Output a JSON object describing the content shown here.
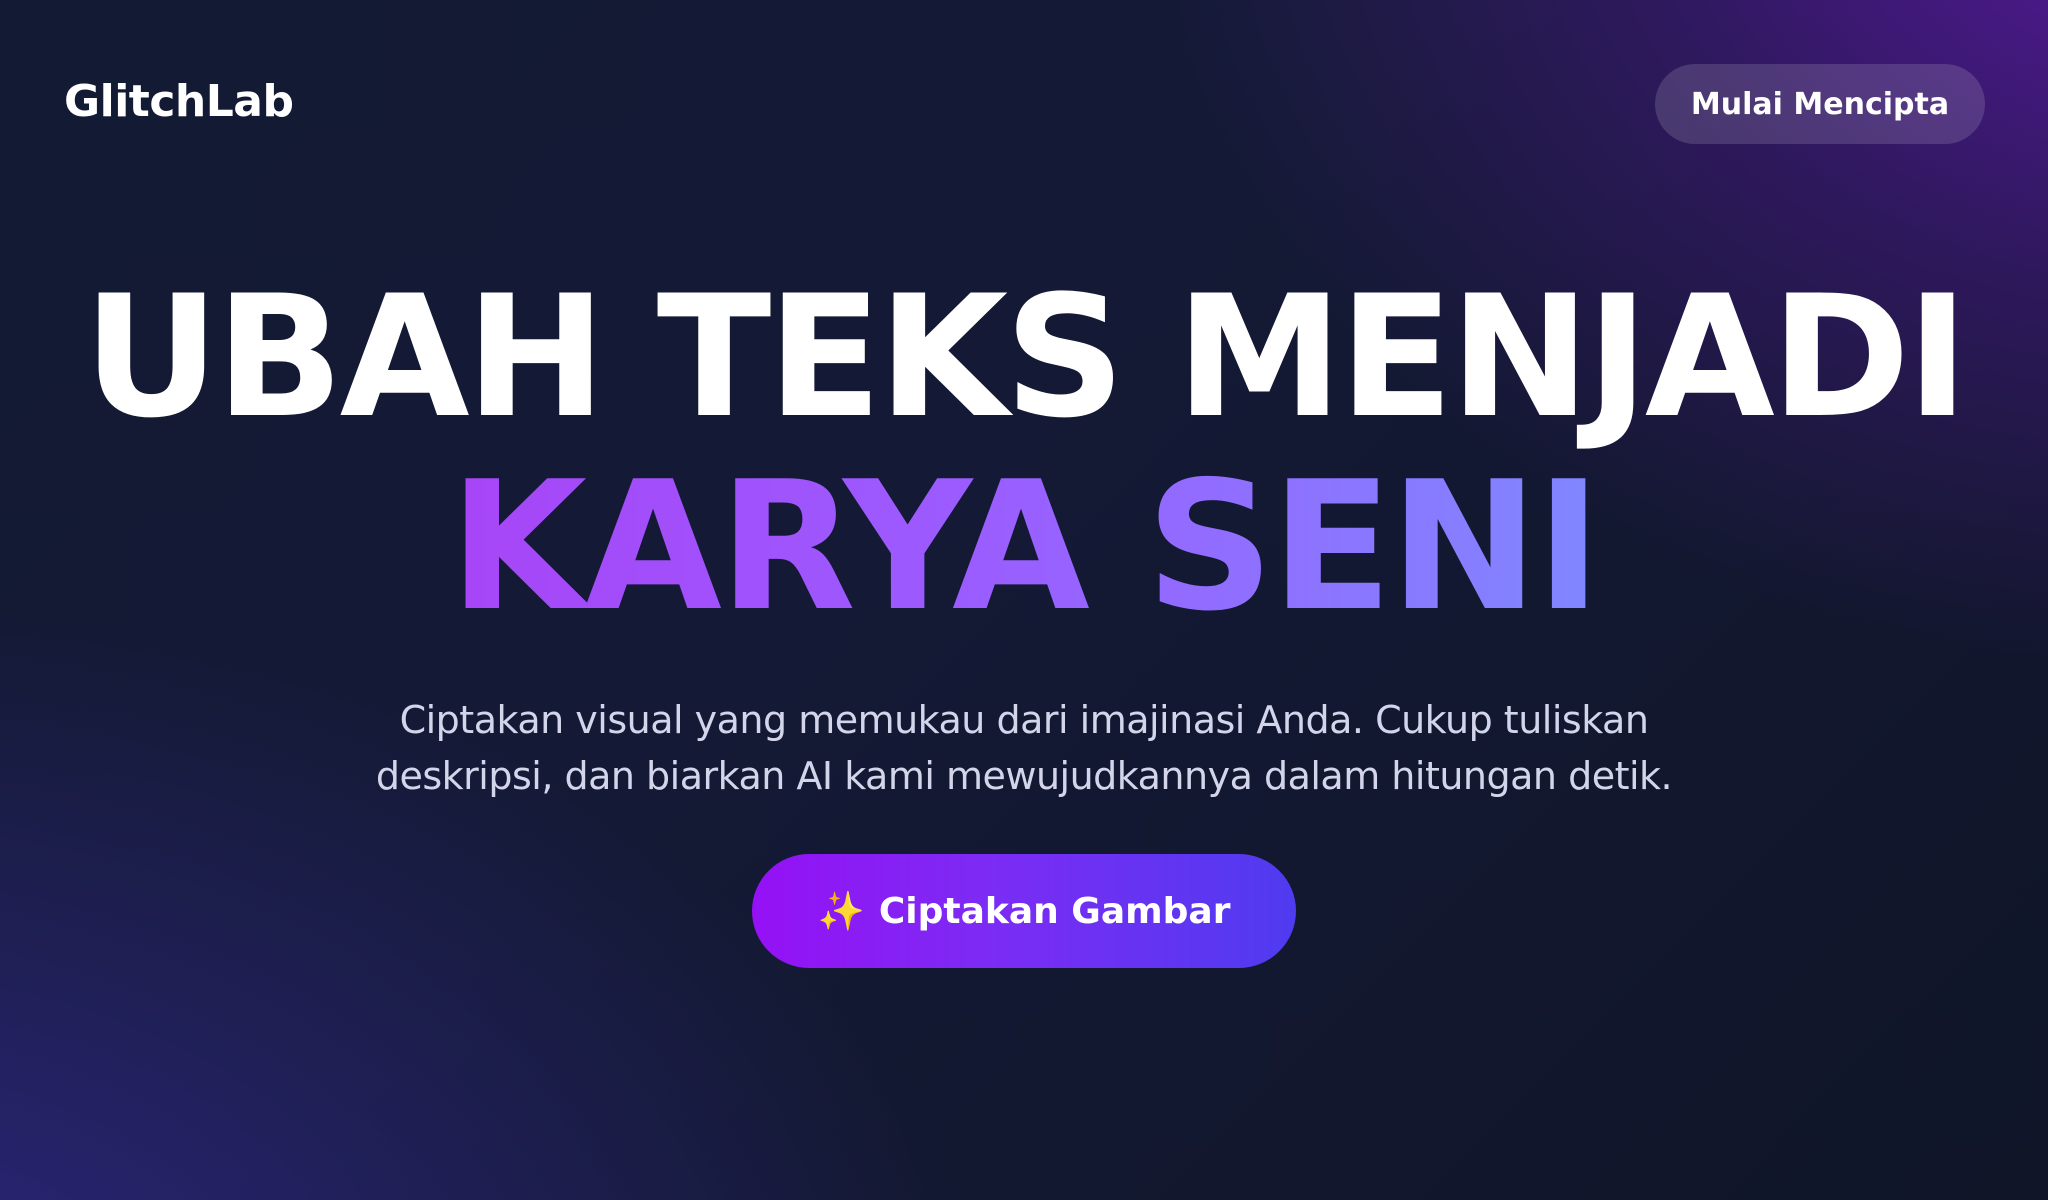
{
  "header": {
    "brand": "GlitchLab",
    "cta_label": "Mulai Mencipta"
  },
  "hero": {
    "headline_line1": "UBAH TEKS MENJADI",
    "headline_line2": "KARYA SENI",
    "subtitle_line1": "Ciptakan visual yang memukau dari imajinasi Anda. Cukup tuliskan",
    "subtitle_line2": "deskripsi, dan biarkan AI kami mewujudkannya dalam hitungan detik.",
    "cta_icon": "✨",
    "cta_label": "Ciptakan Gambar"
  },
  "colors": {
    "accent_start": "#9511f5",
    "accent_end": "#4f3bf0",
    "headline_gradient_start": "#a745f7",
    "headline_gradient_end": "#8087ff",
    "sparkle": "#ffd54a"
  },
  "icons": {
    "cta_icon_name": "sparkle-icon"
  }
}
